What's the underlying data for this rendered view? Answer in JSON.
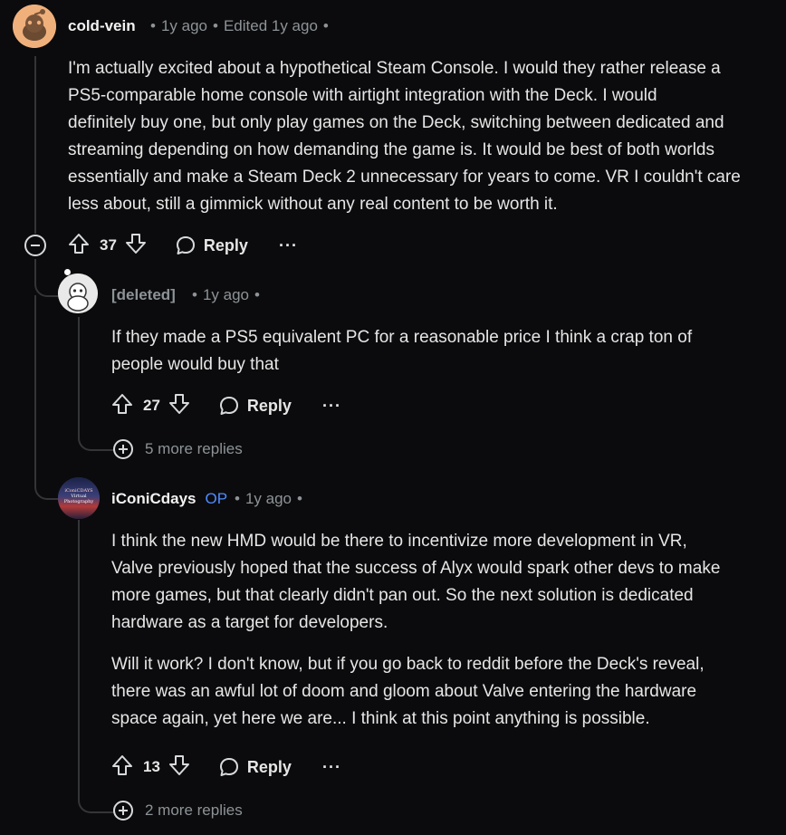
{
  "comments": [
    {
      "username": "cold-vein",
      "time": "1y ago",
      "edited": "Edited 1y ago",
      "body": [
        "I'm actually excited about a hypothetical Steam Console. I would they rather release a",
        "PS5-comparable home console with airtight integration with the Deck. I would",
        "definitely buy one, but only play games on the Deck, switching between dedicated and",
        "streaming depending on how demanding the game is. It would be best of both worlds",
        "essentially and make a Steam Deck 2 unnecessary for years to come. VR I couldn't care",
        "less about, still a gimmick without any real content to be worth it."
      ],
      "votes": "37",
      "reply_label": "Reply",
      "more_label": "···"
    },
    {
      "username": "[deleted]",
      "time": "1y ago",
      "body": [
        "If they made a PS5 equivalent PC for a reasonable price I think a crap ton of",
        "people would buy that"
      ],
      "votes": "27",
      "reply_label": "Reply",
      "more_label": "···",
      "more_replies": "5 more replies"
    },
    {
      "username": "iConiCdays",
      "op_badge": "OP",
      "time": "1y ago",
      "avatar_text": [
        "iConiCDAYS",
        "Virtual",
        "Photography"
      ],
      "body": [
        "I think the new HMD would be there to incentivize more development in VR,",
        "Valve previously hoped that the success of Alyx would spark other devs to make",
        "more games, but that clearly didn't pan out. So the next solution is dedicated",
        "hardware as a target for developers.",
        "",
        "Will it work? I don't know, but if you go back to reddit before the Deck's reveal,",
        "there was an awful lot of doom and gloom about Valve entering the hardware",
        "space again, yet here we are... I think at this point anything is possible."
      ],
      "votes": "13",
      "reply_label": "Reply",
      "more_label": "···",
      "more_replies": "2 more replies"
    }
  ],
  "colors": {
    "background": "#0b0b0d",
    "text": "#e6e6e6",
    "meta": "#8d9396",
    "op": "#4f8cff",
    "thread_line": "#343536"
  }
}
